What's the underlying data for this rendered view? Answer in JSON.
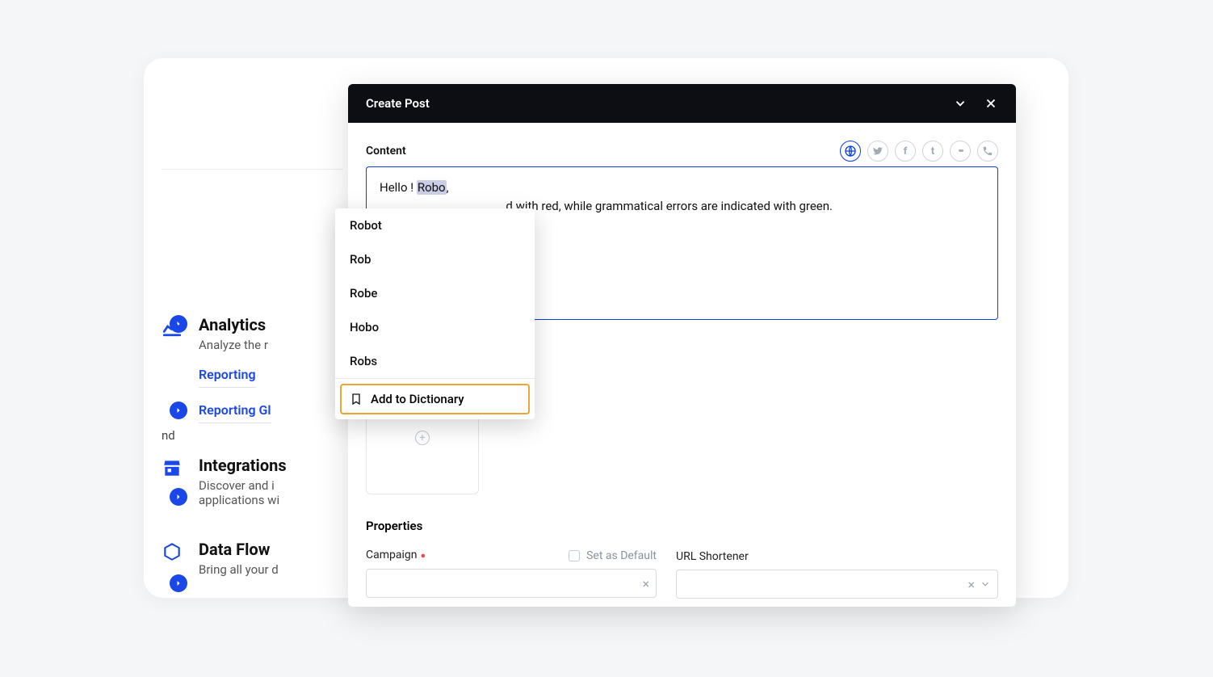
{
  "bg": {
    "analytics": {
      "title": "Analytics",
      "desc": "Analyze the r",
      "link1": "Reporting",
      "link2": "Reporting Gl"
    },
    "integrations": {
      "title": "Integrations",
      "desc": "Discover and i\napplications wi"
    },
    "dataflow": {
      "title": "Data Flow",
      "desc": "Bring all your d"
    },
    "nd_text": "nd"
  },
  "modal": {
    "title": "Create Post",
    "content_label": "Content",
    "text_prefix": "Hello ! ",
    "text_highlight": "Robo",
    "text_suffix": ",",
    "text_line2": "d with red, while grammatical errors are indicated with green.",
    "properties_label": "Properties",
    "campaign_label": "Campaign",
    "default_label": "Set as Default",
    "url_label": "URL Shortener"
  },
  "channels": [
    "globe",
    "twitter",
    "facebook",
    "tumblr",
    "flickr",
    "viber"
  ],
  "spellcheck": {
    "suggestions": [
      "Robot",
      "Rob",
      "Robe",
      "Hobo",
      "Robs"
    ],
    "add_label": "Add to Dictionary"
  }
}
